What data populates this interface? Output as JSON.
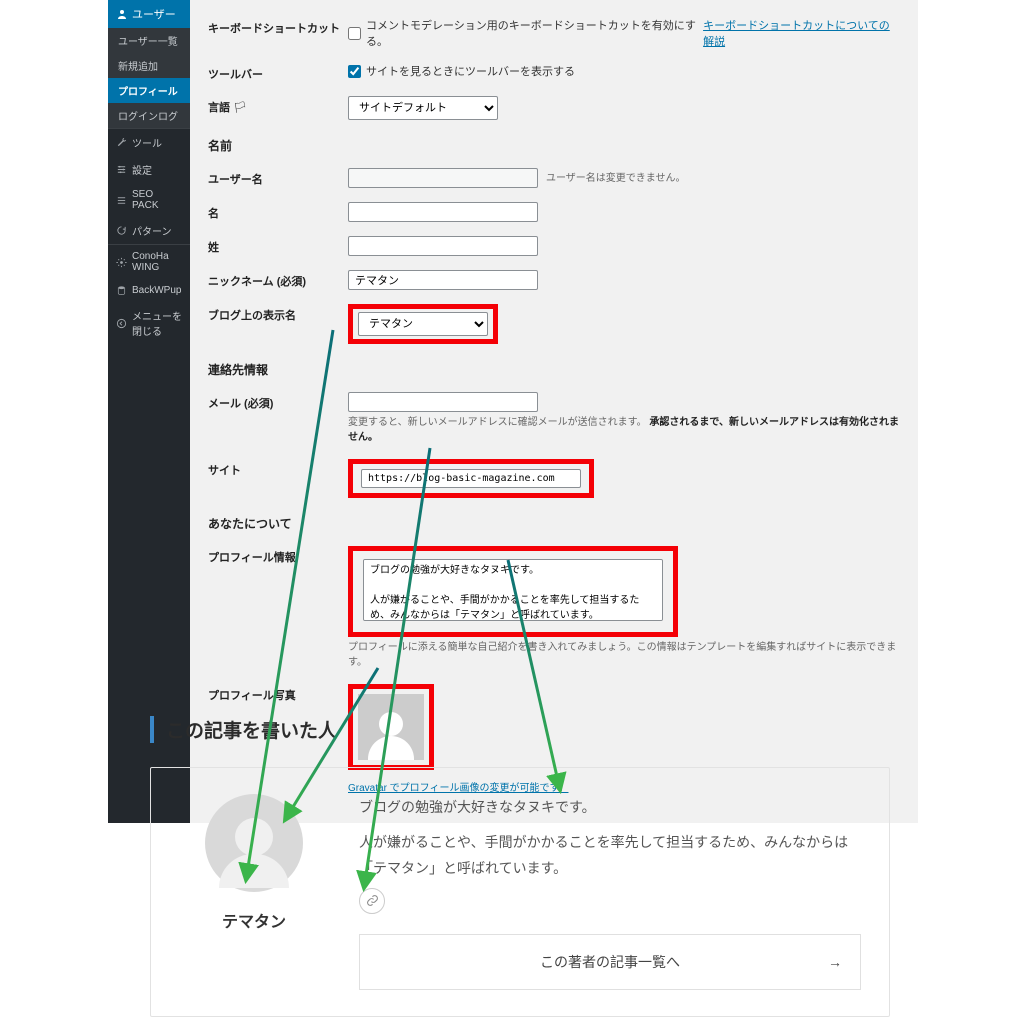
{
  "sidebar": {
    "header": "ユーザー",
    "sub": [
      "ユーザー一覧",
      "新規追加",
      "プロフィール",
      "ログインログ"
    ],
    "items": [
      {
        "icon": "wrench",
        "label": "ツール"
      },
      {
        "icon": "sliders",
        "label": "設定"
      },
      {
        "icon": "list",
        "label": "SEO PACK"
      },
      {
        "icon": "refresh",
        "label": "パターン"
      },
      {
        "icon": "gear",
        "label": "ConoHa WING"
      },
      {
        "icon": "db",
        "label": "BackWPup"
      },
      {
        "icon": "collapse",
        "label": "メニューを閉じる"
      }
    ]
  },
  "form": {
    "kb_label": "キーボードショートカット",
    "kb_text": "コメントモデレーション用のキーボードショートカットを有効にする。",
    "kb_link": "キーボードショートカットについての解説",
    "toolbar_label": "ツールバー",
    "toolbar_text": "サイトを見るときにツールバーを表示する",
    "lang_label": "言語",
    "lang_value": "サイトデフォルト",
    "name_heading": "名前",
    "username_label": "ユーザー名",
    "username_note": "ユーザー名は変更できません。",
    "first_label": "名",
    "last_label": "姓",
    "nick_label": "ニックネーム (必須)",
    "nick_value": "テマタン",
    "display_label": "ブログ上の表示名",
    "display_value": "テマタン",
    "contact_heading": "連絡先情報",
    "mail_label": "メール (必須)",
    "mail_note_a": "変更すると、新しいメールアドレスに確認メールが送信されます。",
    "mail_note_b": "承認されるまで、新しいメールアドレスは有効化されません。",
    "site_label": "サイト",
    "site_value": "https://blog-basic-magazine.com",
    "about_heading": "あなたについて",
    "bio_label": "プロフィール情報",
    "bio_value": "ブログの勉強が大好きなタヌキです。\n\n人が嫌がることや、手間がかかることを率先して担当するため、みんなからは「テマタン」と呼ばれています。",
    "bio_note": "プロフィールに添える簡単な自己紹介を書き入れてみましょう。この情報はテンプレートを編集すればサイトに表示できます。",
    "photo_label": "プロフィール写真",
    "gravatar_link": "Gravatar でプロフィール画像の変更が可能です。"
  },
  "preview": {
    "heading": "この記事を書いた人",
    "name": "テマタン",
    "bio1": "ブログの勉強が大好きなタヌキです。",
    "bio2": "人が嫌がることや、手間がかかることを率先して担当するため、みんなからは「テマタン」と呼ばれています。",
    "button": "この著者の記事一覧へ",
    "arrow": "→"
  }
}
